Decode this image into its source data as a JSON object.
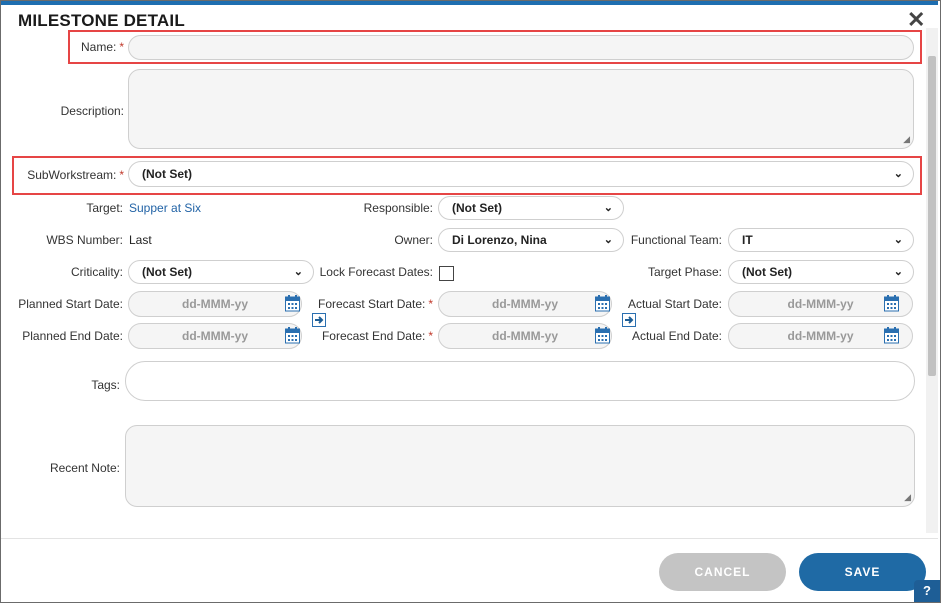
{
  "dialog": {
    "title": "MILESTONE DETAIL",
    "close_glyph": "✕"
  },
  "form": {
    "name": {
      "label": "Name:",
      "required": "*",
      "value": ""
    },
    "description": {
      "label": "Description:",
      "value": ""
    },
    "subworkstream": {
      "label": "SubWorkstream:",
      "required": "*",
      "value": "(Not Set)"
    },
    "target": {
      "label": "Target:",
      "value": "Supper at Six"
    },
    "responsible": {
      "label": "Responsible:",
      "value": "(Not Set)"
    },
    "wbs": {
      "label": "WBS Number:",
      "value": "Last"
    },
    "owner": {
      "label": "Owner:",
      "value": "Di Lorenzo, Nina"
    },
    "functional_team": {
      "label": "Functional Team:",
      "value": "IT"
    },
    "criticality": {
      "label": "Criticality:",
      "value": "(Not Set)"
    },
    "lock_forecast": {
      "label": "Lock Forecast Dates:",
      "checked": false
    },
    "target_phase": {
      "label": "Target Phase:",
      "value": "(Not Set)"
    },
    "planned_start": {
      "label": "Planned Start Date:",
      "placeholder": "dd-MMM-yy"
    },
    "forecast_start": {
      "label": "Forecast Start Date:",
      "required": "*",
      "placeholder": "dd-MMM-yy"
    },
    "actual_start": {
      "label": "Actual Start Date:",
      "placeholder": "dd-MMM-yy"
    },
    "planned_end": {
      "label": "Planned End Date:",
      "placeholder": "dd-MMM-yy"
    },
    "forecast_end": {
      "label": "Forecast End Date:",
      "required": "*",
      "placeholder": "dd-MMM-yy"
    },
    "actual_end": {
      "label": "Actual End Date:",
      "placeholder": "dd-MMM-yy"
    },
    "tags": {
      "label": "Tags:",
      "value": ""
    },
    "recent_note": {
      "label": "Recent Note:",
      "value": ""
    }
  },
  "footer": {
    "cancel_label": "CANCEL",
    "save_label": "SAVE",
    "help_glyph": "?"
  },
  "colors": {
    "accent": "#1e6eb0",
    "highlight": "#e64545",
    "required": "#c0392b",
    "cancel_bg": "#c4c4c4",
    "save_bg": "#1f6aa5"
  },
  "icons": [
    "close-icon",
    "chevron-down-icon",
    "calendar-icon",
    "copy-arrow-icon",
    "help-icon",
    "resize-grip-icon"
  ]
}
